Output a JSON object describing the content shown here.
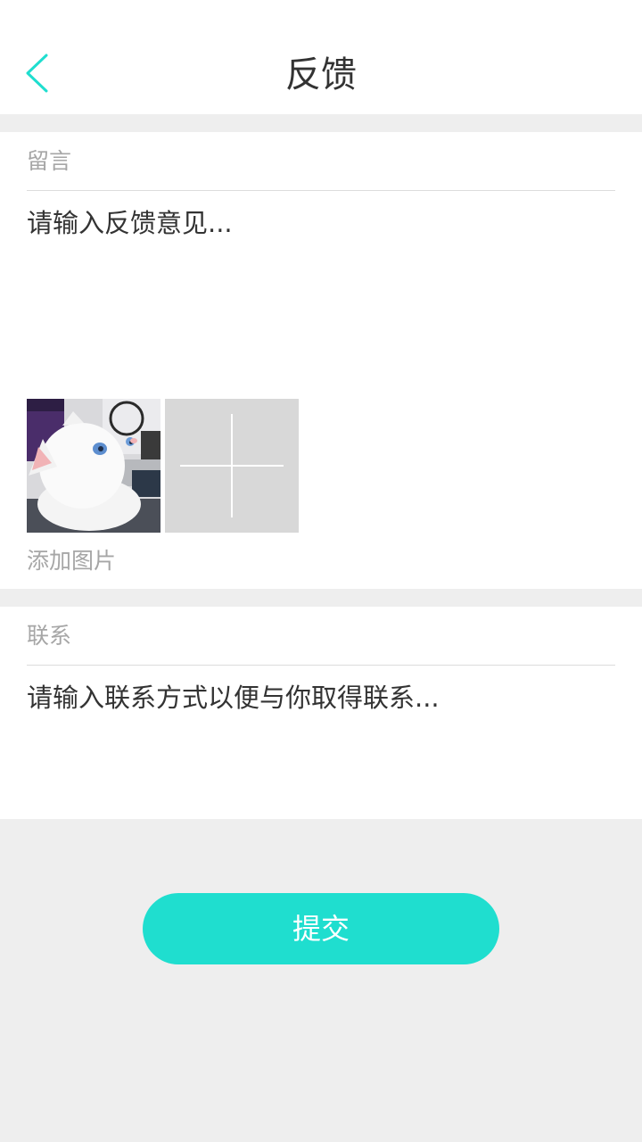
{
  "header": {
    "title": "反馈",
    "back_icon": "chevron-left-icon",
    "accent_color": "#1fdecf"
  },
  "message_section": {
    "label": "留言",
    "placeholder": "请输入反馈意见...",
    "value": "",
    "attached_photo_icon": "white-cat-photo",
    "add_photo_icon": "plus-icon",
    "add_photo_label": "添加图片"
  },
  "contact_section": {
    "label": "联系",
    "placeholder": "请输入联系方式以便与你取得联系...",
    "value": ""
  },
  "submit": {
    "label": "提交",
    "color": "#1fdecf"
  }
}
